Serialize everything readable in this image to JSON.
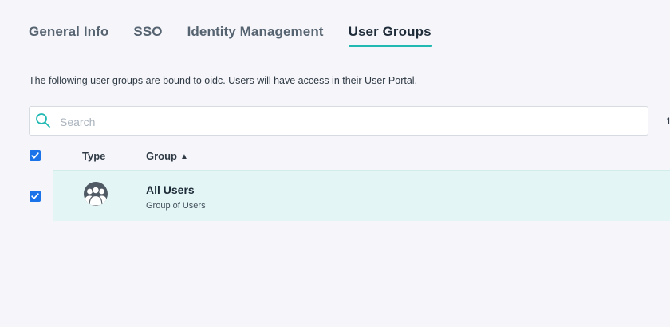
{
  "tabs": [
    {
      "label": "General Info",
      "active": false
    },
    {
      "label": "SSO",
      "active": false
    },
    {
      "label": "Identity Management",
      "active": false
    },
    {
      "label": "User Groups",
      "active": true
    }
  ],
  "description": "The following user groups are bound to oidc. Users will have access in their User Portal.",
  "search": {
    "placeholder": "Search",
    "value": ""
  },
  "result_count": "1",
  "table": {
    "header": {
      "select_all_checked": true,
      "type_label": "Type",
      "group_label": "Group",
      "sort": "ascending"
    },
    "rows": [
      {
        "checked": true,
        "type_icon": "user-group-icon",
        "name": "All Users",
        "subtitle": "Group of Users"
      }
    ]
  },
  "colors": {
    "accent": "#22b9b3",
    "checkbox": "#1a73e8",
    "row_highlight": "#e3f6f5",
    "background": "#f6f6fa"
  }
}
